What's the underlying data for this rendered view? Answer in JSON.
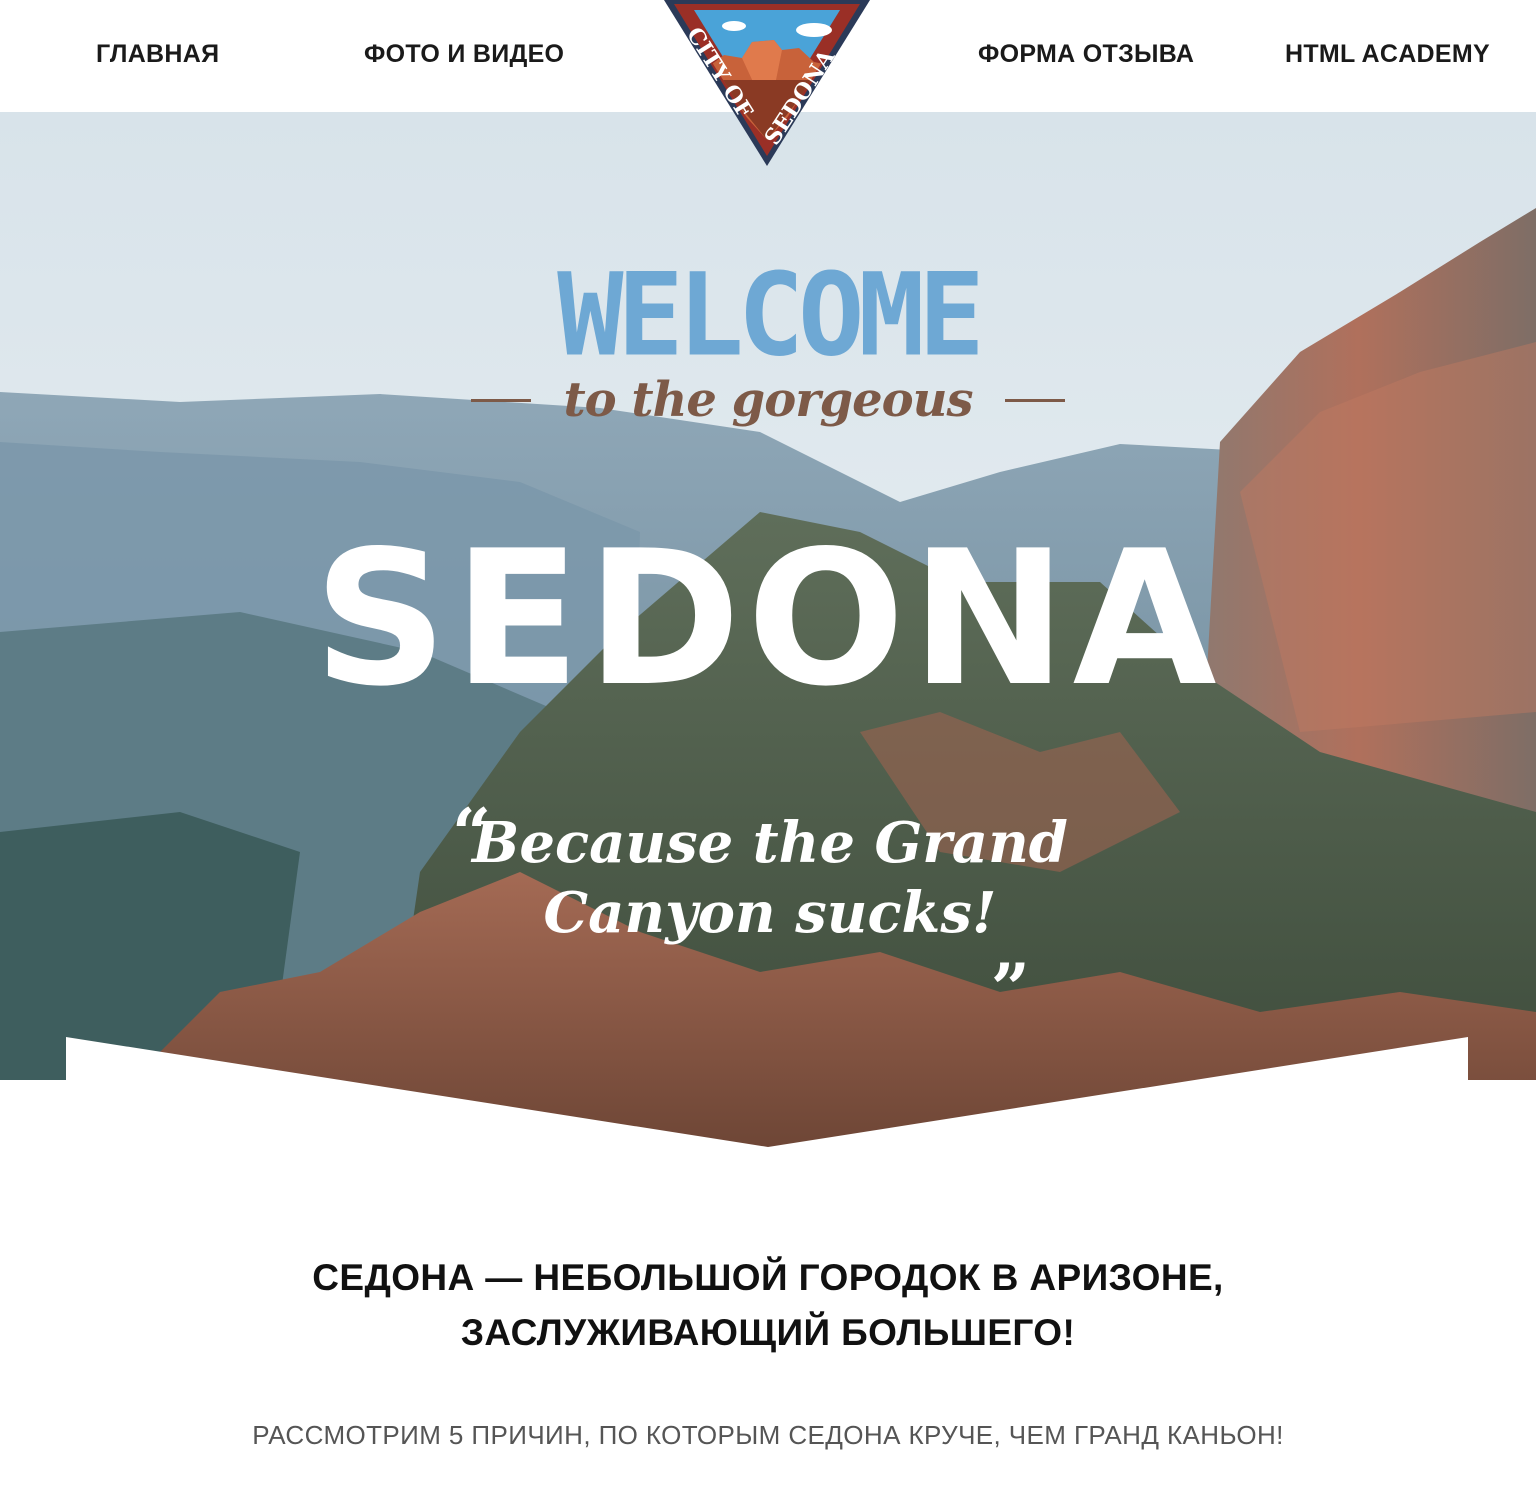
{
  "nav": {
    "items": [
      {
        "label": "ГЛАВНАЯ"
      },
      {
        "label": "ФОТО И ВИДЕО"
      },
      {
        "label": "ФОРМА ОТЗЫВА"
      },
      {
        "label": "HTML ACADEMY"
      }
    ],
    "logo": {
      "text": "CITY OF SEDONA",
      "icon": "city-of-sedona-logo-icon"
    }
  },
  "hero": {
    "welcome": "WELCOME",
    "tagline": "to the gorgeous",
    "title": "SEDONA",
    "quote_line1": "Because the Grand",
    "quote_line2": "Canyon sucks!",
    "quote_open": "“",
    "quote_close": "„"
  },
  "content": {
    "headline_line1": "СЕДОНА — НЕБОЛЬШОЙ ГОРОДОК В АРИЗОНЕ,",
    "headline_line2": "ЗАСЛУЖИВАЮЩИЙ БОЛЬШЕГО!",
    "subline": "РАССМОТРИМ 5 ПРИЧИН, ПО КОТОРЫМ СЕДОНА КРУЧЕ, ЧЕМ ГРАНД КАНЬОН!"
  },
  "colors": {
    "welcome": "#6ea8d4",
    "tagline": "#7d5a48",
    "logo_navy": "#2b3a58",
    "logo_red": "#9a2f26",
    "logo_sky": "#4aa3d8",
    "text_dark": "#111111"
  }
}
